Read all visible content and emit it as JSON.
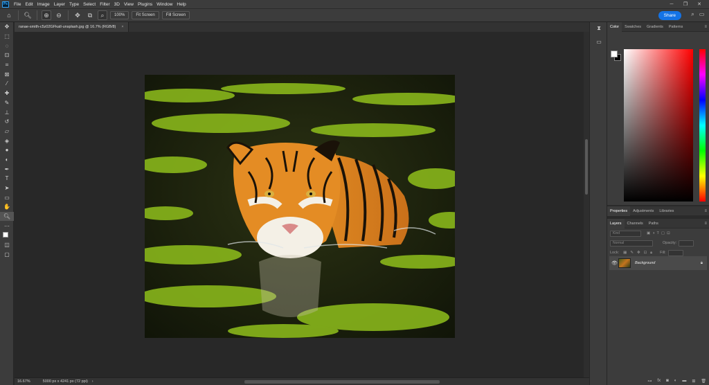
{
  "app": {
    "logo": "Ps"
  },
  "menu": [
    "File",
    "Edit",
    "Image",
    "Layer",
    "Type",
    "Select",
    "Filter",
    "3D",
    "View",
    "Plugins",
    "Window",
    "Help"
  ],
  "window_controls": [
    "─",
    "❐",
    "✕"
  ],
  "options": {
    "zoom_value": "100%",
    "fit_screen": "Fit Screen",
    "fill_screen": "Fill Screen",
    "share": "Share"
  },
  "document": {
    "tab_title": "ranae-smith-c5z02GFkatl-unsplash.jpg @ 16.7% (RGB/8)",
    "close": "×"
  },
  "status": {
    "zoom": "16.67%",
    "dimensions": "5000 px x 4241 px (72 ppi)",
    "arrow": "›"
  },
  "color_panel": {
    "tabs": [
      "Color",
      "Swatches",
      "Gradients",
      "Patterns"
    ],
    "active": "Color",
    "foreground": "#ffffff",
    "background": "#000000"
  },
  "props_panel": {
    "tabs": [
      "Properties",
      "Adjustments",
      "Libraries"
    ]
  },
  "layers_panel": {
    "tabs": [
      "Layers",
      "Channels",
      "Paths"
    ],
    "filter_placeholder": "Kind",
    "blend_mode": "Normal",
    "opacity_label": "Opacity:",
    "lock_label": "Lock:",
    "fill_label": "Fill:",
    "layers": [
      {
        "name": "Background",
        "visible": true,
        "locked": true
      }
    ]
  },
  "icons": {
    "home": "home-icon",
    "zoom": "zoom-icon"
  }
}
